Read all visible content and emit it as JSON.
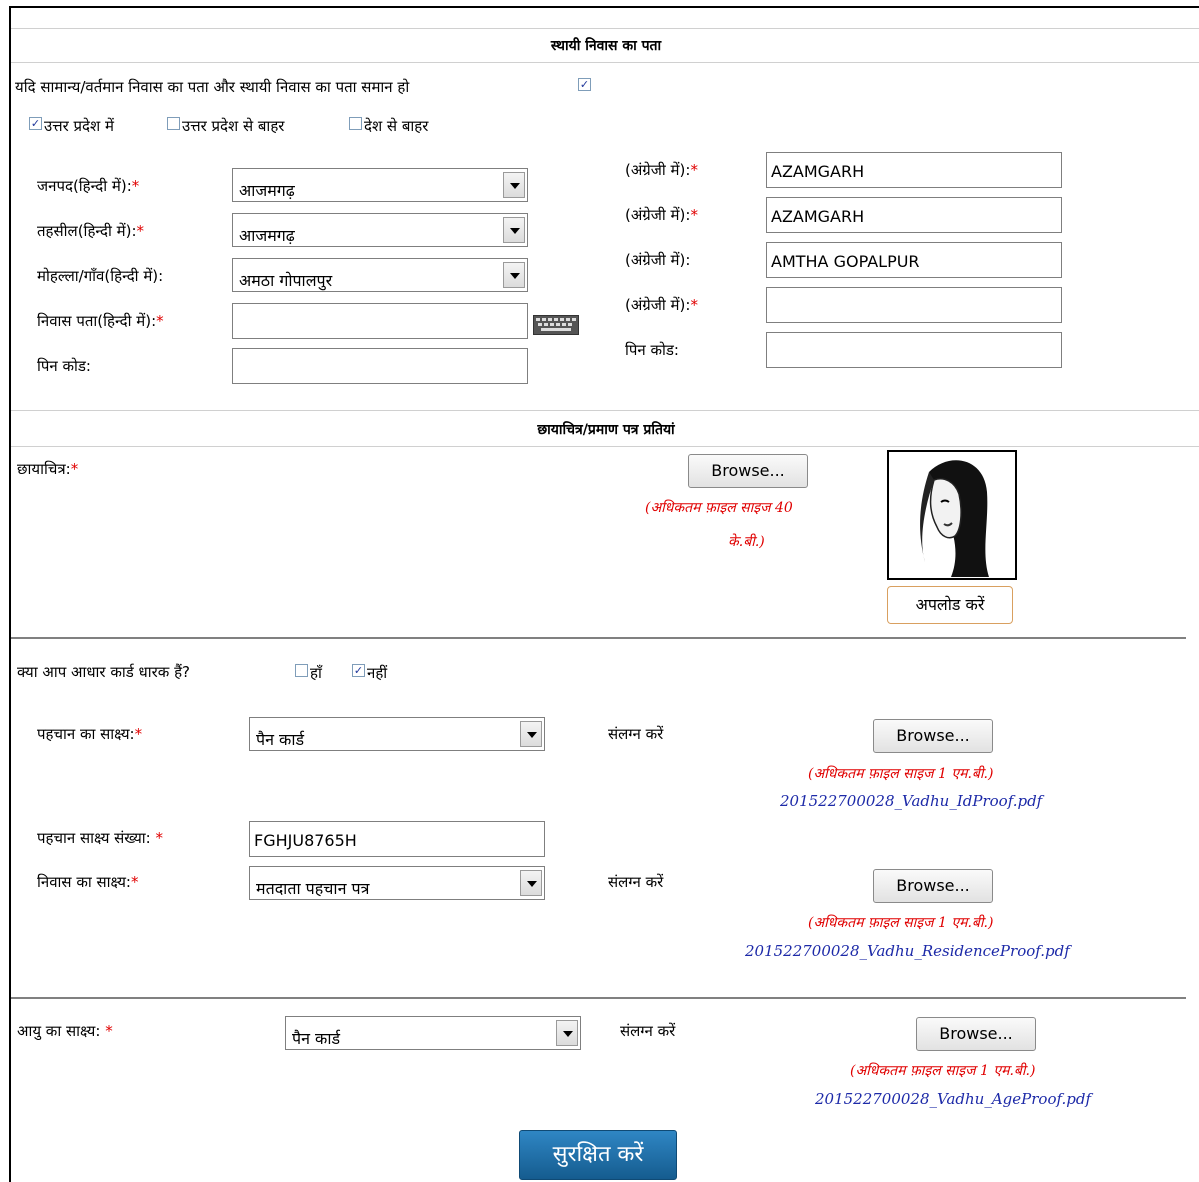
{
  "permanent_address": {
    "section_title": "स्थायी निवास का पता",
    "same_address_label": "यदि सामान्य/वर्तमान निवास का पता और स्थायी निवास का पता समान हो",
    "same_address_checked": true,
    "location_options": [
      {
        "label": "उत्तर प्रदेश में",
        "checked": true
      },
      {
        "label": "उत्तर प्रदेश से बाहर",
        "checked": false
      },
      {
        "label": "देश से बाहर",
        "checked": false
      }
    ],
    "district_label": "जनपद(हिन्दी में):",
    "district_value": "आजमगढ़",
    "tehsil_label": "तहसील(हिन्दी में):",
    "tehsil_value": "आजमगढ़",
    "village_label": "मोहल्ला/गाँव(हिन्दी में):",
    "village_value": "अमठा गोपालपुर",
    "address_label": "निवास पता(हिन्दी में):",
    "address_value": "",
    "pincode_label": "पिन कोड:",
    "pincode_value": "",
    "english_label": "(अंग्रेजी में):",
    "district_en": "AZAMGARH",
    "tehsil_en": "AZAMGARH",
    "village_en": "AMTHA GOPALPUR",
    "address_en": "",
    "pincode_en_label": "पिन कोड:",
    "pincode_en": "",
    "required_mark": "*"
  },
  "documents": {
    "section_title": "छायाचित्र/प्रमाण पत्र प्रतियां",
    "photo_label": "छायाचित्र:",
    "browse_label": "Browse...",
    "photo_note_line1": "(अधिकतम फ़ाइल साइज 40",
    "photo_note_line2": "के.बी.)",
    "upload_label": "अपलोड करें"
  },
  "aadhaar": {
    "question": "क्या आप आधार कार्ड धारक हैं?",
    "yes_label": "हाँ",
    "yes_checked": false,
    "no_label": "नहीं",
    "no_checked": true
  },
  "identity": {
    "proof_label": "पहचान का साक्ष्य:",
    "proof_value": "पैन कार्ड",
    "attach_label": "संलग्न करें",
    "size_note": "(अधिकतम फ़ाइल साइज 1 एम.बी.)",
    "file_name": "201522700028_Vadhu_IdProof.pdf",
    "number_label": "पहचान साक्ष्य संख्या:",
    "number_value": "FGHJU8765H"
  },
  "residence": {
    "proof_label": "निवास का साक्ष्य:",
    "proof_value": "मतदाता पहचान पत्र",
    "attach_label": "संलग्न करें",
    "size_note": "(अधिकतम फ़ाइल साइज 1 एम.बी.)",
    "file_name": "201522700028_Vadhu_ResidenceProof.pdf"
  },
  "age": {
    "proof_label": "आयु का साक्ष्य:",
    "proof_value": "पैन कार्ड",
    "attach_label": "संलग्न करें",
    "size_note": "(अधिकतम फ़ाइल साइज 1 एम.बी.)",
    "file_name": "201522700028_Vadhu_AgeProof.pdf"
  },
  "save_label": "सुरक्षित करें",
  "colors": {
    "required": "#e00000",
    "file_link": "#1d2aa8",
    "save_button": "#1c6fa8"
  }
}
